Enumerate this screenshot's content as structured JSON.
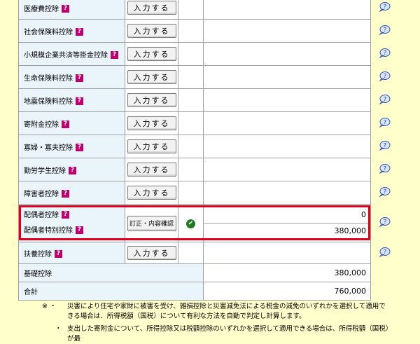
{
  "rows": [
    {
      "label": "医療費控除",
      "button": "入力する"
    },
    {
      "label": "社会保険料控除",
      "button": "入力する"
    },
    {
      "label": "小規模企業共済等掛金控除",
      "button": "入力する"
    },
    {
      "label": "生命保険料控除",
      "button": "入力する"
    },
    {
      "label": "地震保険料控除",
      "button": "入力する"
    },
    {
      "label": "寄附金控除",
      "button": "入力する"
    },
    {
      "label": "寡婦・寡夫控除",
      "button": "入力する"
    },
    {
      "label": "勤労学生控除",
      "button": "入力する"
    },
    {
      "label": "障害者控除",
      "button": "入力する"
    }
  ],
  "spouse": {
    "label1": "配偶者控除",
    "label2": "配偶者特別控除",
    "button": "訂正・内容確認",
    "amount1": "0",
    "amount2": "380,000"
  },
  "dependents": {
    "label": "扶養控除",
    "button": "入力する"
  },
  "basic": {
    "label": "基礎控除",
    "amount": "380,000"
  },
  "total": {
    "label": "合計",
    "amount": "760,000"
  },
  "help_mark": "?",
  "check_mark": "✔",
  "notes": [
    {
      "mark": "※ ・",
      "text": "災害により住宅や家財に被害を受け、雑損控除と災害減免法による税金の減免のいずれかを選択して適用できる場合は、所得税額（国税）について有利な方法を自動で判定し計算します。"
    },
    {
      "mark": "・",
      "text": "支出した寄附金について、所得控除又は税額控除のいずれかを選択して適用できる場合は、所得税額（国税）が最"
    }
  ],
  "colors": {
    "highlight": "#e0001b",
    "label_bg": "#eaf4fb",
    "page_bg": "#ffffcc",
    "qicon": "#c0006f"
  }
}
